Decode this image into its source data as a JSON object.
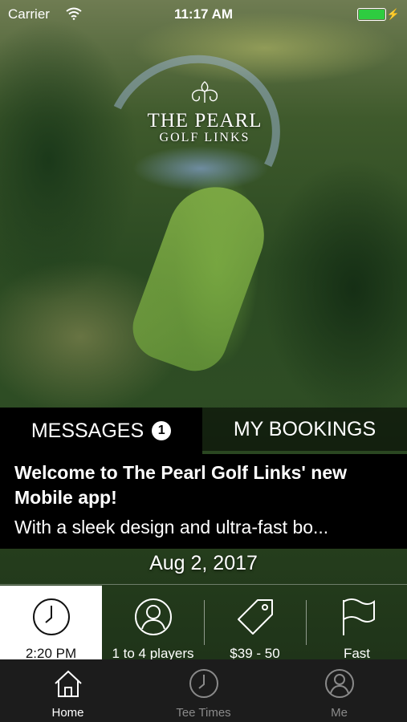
{
  "status_bar": {
    "carrier": "Carrier",
    "time": "11:17 AM",
    "battery_color": "#2ecc40"
  },
  "logo": {
    "line1": "THE PEARL",
    "line2": "GOLF LINKS"
  },
  "tabs": [
    {
      "label": "MESSAGES",
      "badge": "1",
      "selected": true
    },
    {
      "label": "MY BOOKINGS",
      "selected": false
    }
  ],
  "message": {
    "title": "Welcome to The Pearl Golf Links' new Mobile app!",
    "body": "With a sleek design and ultra-fast bo...",
    "date": "Aug 2, 2017"
  },
  "filters": [
    {
      "icon": "clock-icon",
      "label": "2:20 PM",
      "selected": true
    },
    {
      "icon": "user-icon",
      "label": "1 to 4 players",
      "selected": false
    },
    {
      "icon": "price-tag-icon",
      "label": "$39 - 50",
      "selected": false
    },
    {
      "icon": "flag-icon",
      "label": "Fast",
      "selected": false
    }
  ],
  "tab_bar": [
    {
      "icon": "home-icon",
      "label": "Home",
      "active": true
    },
    {
      "icon": "clock-icon",
      "label": "Tee Times",
      "active": false
    },
    {
      "icon": "user-icon",
      "label": "Me",
      "active": false
    }
  ],
  "colors": {
    "tab_bar_background": "#1c1c1c",
    "inactive_tab": "#8a8a8a",
    "active_tab": "#ffffff"
  }
}
